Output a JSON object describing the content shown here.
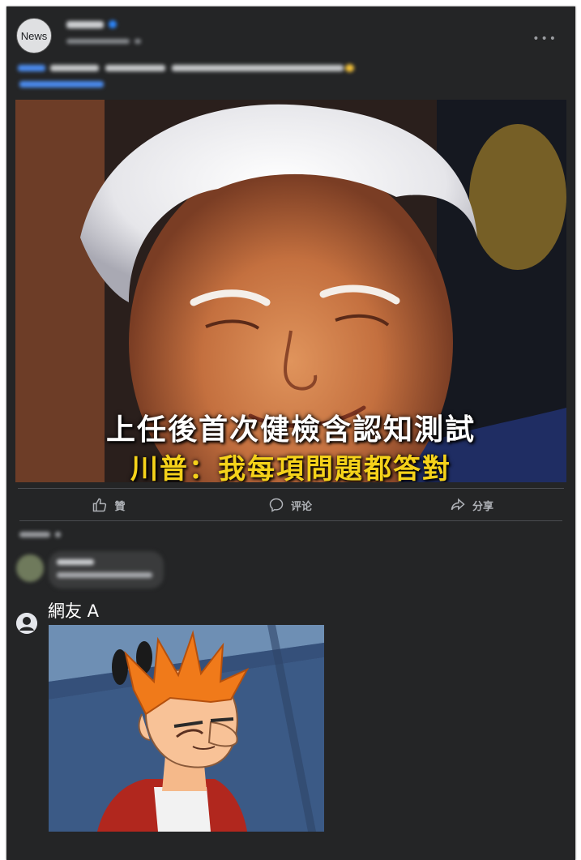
{
  "post": {
    "page_avatar_text": "News",
    "image_caption_line1": "上任後首次健檢含認知測試",
    "image_caption_line2": "川普：我每項問題都答對",
    "more_icon": "ellipsis-icon"
  },
  "actions": {
    "like_label": "贊",
    "comment_label": "评论",
    "share_label": "分享",
    "like_icon": "thumbs-up-icon",
    "comment_icon": "speech-bubble-icon",
    "share_icon": "share-arrow-icon"
  },
  "comment": {
    "author": "網友 A",
    "avatar_icon": "user-icon"
  },
  "colors": {
    "card_bg": "#242526",
    "caption_yellow": "#f5d21a",
    "verified_blue": "#2d88ff"
  }
}
